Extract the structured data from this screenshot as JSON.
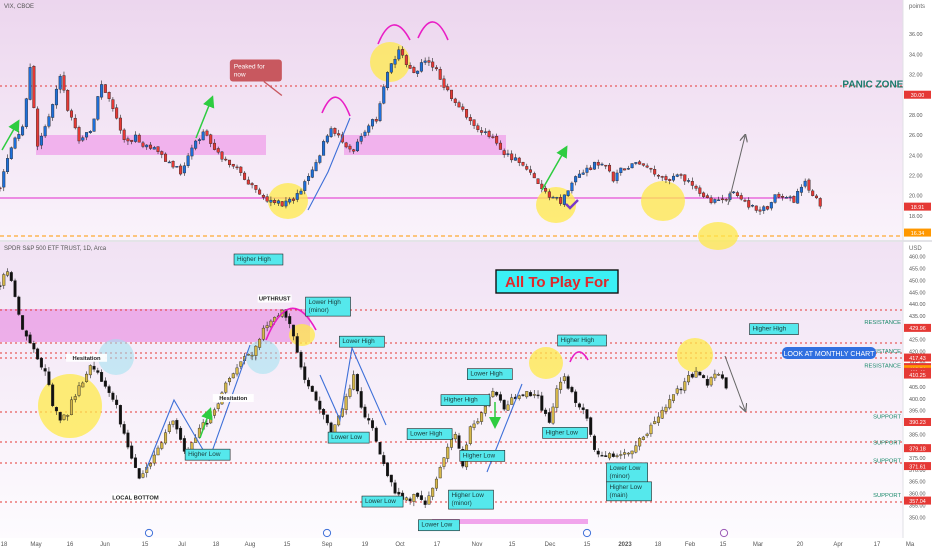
{
  "chart_data": [
    {
      "panel": "top",
      "type": "candlestick",
      "title": "VIX, CBOE",
      "axis_unit": "points",
      "ylim": [
        16,
        38
      ],
      "y_ticks": [
        "36.00",
        "34.00",
        "32.00",
        "30.00",
        "28.00",
        "26.00",
        "24.00",
        "22.00",
        "20.00",
        "18.00"
      ],
      "price_badges": [
        {
          "label": "30.00",
          "value": 30.0,
          "color": "#e53935"
        },
        {
          "label": "18.91",
          "value": 18.91,
          "color": "#e53935"
        },
        {
          "label": "16.34",
          "value": 16.34,
          "color": "#ff9800"
        }
      ],
      "annotations": [
        {
          "text": "Peaked for now",
          "x": 68,
          "y": 32.5
        },
        {
          "text": "PANIC ZONE",
          "x": 232,
          "y": 30.7
        }
      ],
      "close_path": [
        [
          0,
          20.8
        ],
        [
          3,
          25
        ],
        [
          6,
          26.8
        ],
        [
          8,
          32.5
        ],
        [
          10,
          25.2
        ],
        [
          13,
          27.8
        ],
        [
          16,
          32
        ],
        [
          18,
          28.5
        ],
        [
          21,
          25.6
        ],
        [
          24,
          26.2
        ],
        [
          27,
          31.2
        ],
        [
          30,
          28.8
        ],
        [
          33,
          25.4
        ],
        [
          36,
          25.8
        ],
        [
          39,
          24.8
        ],
        [
          42,
          24.3
        ],
        [
          45,
          23.2
        ],
        [
          48,
          22.4
        ],
        [
          51,
          24.8
        ],
        [
          54,
          26.4
        ],
        [
          57,
          24.6
        ],
        [
          60,
          23.4
        ],
        [
          63,
          22.8
        ],
        [
          66,
          21.2
        ],
        [
          69,
          20.4
        ],
        [
          72,
          19.4
        ],
        [
          75,
          19.2
        ],
        [
          78,
          19.6
        ],
        [
          80,
          20.5
        ],
        [
          82,
          21.8
        ],
        [
          85,
          24.2
        ],
        [
          88,
          26.8
        ],
        [
          91,
          25.4
        ],
        [
          94,
          24.6
        ],
        [
          97,
          26.6
        ],
        [
          100,
          27.6
        ],
        [
          103,
          32.4
        ],
        [
          106,
          34.4
        ],
        [
          108,
          33.2
        ],
        [
          110,
          32.2
        ],
        [
          113,
          33.6
        ],
        [
          116,
          32.6
        ],
        [
          119,
          30.2
        ],
        [
          122,
          28.8
        ],
        [
          125,
          27.2
        ],
        [
          128,
          26.4
        ],
        [
          131,
          25.8
        ],
        [
          134,
          24.2
        ],
        [
          137,
          23.6
        ],
        [
          140,
          22.6
        ],
        [
          143,
          21
        ],
        [
          146,
          19.8
        ],
        [
          149,
          19.4
        ],
        [
          152,
          21.2
        ],
        [
          155,
          22.4
        ],
        [
          158,
          23.1
        ],
        [
          161,
          22.8
        ],
        [
          163,
          21.6
        ],
        [
          165,
          22.6
        ],
        [
          168,
          23.1
        ],
        [
          171,
          22.8
        ],
        [
          174,
          22.1
        ],
        [
          177,
          21.6
        ],
        [
          180,
          21.9
        ],
        [
          183,
          21.4
        ],
        [
          186,
          20.1
        ],
        [
          189,
          19.4
        ],
        [
          192,
          19.6
        ],
        [
          195,
          20.1
        ],
        [
          198,
          19.2
        ],
        [
          201,
          18.8
        ],
        [
          204,
          18.5
        ],
        [
          206,
          19.8
        ],
        [
          209,
          20.1
        ],
        [
          211,
          19.6
        ],
        [
          214,
          21.2
        ],
        [
          216,
          20.3
        ],
        [
          218,
          18.9
        ]
      ]
    },
    {
      "panel": "bottom",
      "type": "candlestick",
      "title": "SPDR S&P 500 ETF TRUST, 1D, Arca",
      "axis_unit": "USD",
      "ylim": [
        348,
        462
      ],
      "y_ticks": [
        "460.00",
        "455.00",
        "450.00",
        "445.00",
        "440.00",
        "435.00",
        "430.00",
        "425.00",
        "420.00",
        "415.00",
        "410.00",
        "405.00",
        "400.00",
        "395.00",
        "390.00",
        "385.00",
        "380.00",
        "375.00",
        "370.00",
        "365.00",
        "360.00",
        "355.00",
        "350.00"
      ],
      "price_badges": [
        {
          "label": "429.96",
          "value": 429.96,
          "color": "#e53935"
        },
        {
          "label": "417.43",
          "value": 417.43,
          "color": "#e53935"
        },
        {
          "label": "413.40",
          "value": 413.4,
          "color": "#e53935"
        },
        {
          "label": "412.54",
          "value": 412.54,
          "color": "#ff9800"
        },
        {
          "label": "411.41",
          "value": 411.41,
          "color": "#e53935"
        },
        {
          "label": "410.25",
          "value": 410.25,
          "color": "#e53935"
        },
        {
          "label": "390.23",
          "value": 390.23,
          "color": "#e53935"
        },
        {
          "label": "379.18",
          "value": 379.18,
          "color": "#e53935"
        },
        {
          "label": "371.61",
          "value": 371.61,
          "color": "#e53935"
        },
        {
          "label": "357.04",
          "value": 357.04,
          "color": "#e53935"
        }
      ],
      "level_labels": [
        {
          "text": "RESISTANCE",
          "y": 431.5
        },
        {
          "text": "SUPPORT, NOW ACTING AS RESISTANCE",
          "y": 419.3
        },
        {
          "text": "RESISTANCE",
          "y": 413.3
        },
        {
          "text": "SUPPORT",
          "y": 391.8
        },
        {
          "text": "SUPPORT",
          "y": 380.8
        },
        {
          "text": "SUPPORT",
          "y": 373.2
        },
        {
          "text": "SUPPORT",
          "y": 358.6
        }
      ],
      "headline": "All To Play For",
      "monthly_note": "LOOK AT MONTHLY CHART",
      "annotations": [
        {
          "text": "Higher High",
          "x": 63,
          "y": 458.2
        },
        {
          "text": "UPTHRUST",
          "x": 73,
          "y": 441.5
        },
        {
          "text": "Lower High (minor)",
          "x": 82,
          "y": 440
        },
        {
          "text": "Lower High",
          "x": 91,
          "y": 423.5
        },
        {
          "text": "Higher High",
          "x": 149,
          "y": 424
        },
        {
          "text": "Higher High",
          "x": 200,
          "y": 428.8
        },
        {
          "text": "Hesitation",
          "x": 23,
          "y": 416.5
        },
        {
          "text": "Hesitation",
          "x": 62,
          "y": 399.5
        },
        {
          "text": "Lower High",
          "x": 125,
          "y": 409.8
        },
        {
          "text": "Higher High",
          "x": 118,
          "y": 398.8
        },
        {
          "text": "Higher Low",
          "x": 50,
          "y": 375.8
        },
        {
          "text": "Lower High",
          "x": 109,
          "y": 384.5
        },
        {
          "text": "Lower Low",
          "x": 88,
          "y": 383
        },
        {
          "text": "Higher Low",
          "x": 145,
          "y": 385
        },
        {
          "text": "Higher Low",
          "x": 123,
          "y": 375.3
        },
        {
          "text": "Lower Low (minor)",
          "x": 162,
          "y": 370
        },
        {
          "text": "Higher Low (main)",
          "x": 162,
          "y": 362
        },
        {
          "text": "Higher Low (minor)",
          "x": 120,
          "y": 358.5
        },
        {
          "text": "Lower Low",
          "x": 97,
          "y": 356
        },
        {
          "text": "Lower Low",
          "x": 112,
          "y": 346
        },
        {
          "text": "LOCAL BOTTOM",
          "x": 36,
          "y": 357.5
        }
      ],
      "close_path": [
        [
          0,
          448
        ],
        [
          2,
          455
        ],
        [
          4,
          443
        ],
        [
          6,
          430
        ],
        [
          8,
          424
        ],
        [
          10,
          417
        ],
        [
          12,
          412
        ],
        [
          14,
          398
        ],
        [
          16,
          390
        ],
        [
          18,
          394
        ],
        [
          20,
          402
        ],
        [
          22,
          406
        ],
        [
          24,
          413
        ],
        [
          26,
          410
        ],
        [
          28,
          405
        ],
        [
          31,
          396
        ],
        [
          34,
          380
        ],
        [
          37,
          367
        ],
        [
          40,
          372
        ],
        [
          43,
          383
        ],
        [
          46,
          392
        ],
        [
          49,
          377
        ],
        [
          52,
          384
        ],
        [
          55,
          391
        ],
        [
          58,
          398
        ],
        [
          61,
          410
        ],
        [
          64,
          416
        ],
        [
          67,
          418
        ],
        [
          70,
          431
        ],
        [
          72,
          434
        ],
        [
          75,
          438
        ],
        [
          78,
          428
        ],
        [
          80,
          414
        ],
        [
          82,
          404
        ],
        [
          85,
          397
        ],
        [
          88,
          384
        ],
        [
          90,
          392
        ],
        [
          92,
          401
        ],
        [
          94,
          409
        ],
        [
          96,
          396
        ],
        [
          99,
          387
        ],
        [
          102,
          371
        ],
        [
          105,
          361
        ],
        [
          108,
          357
        ],
        [
          111,
          360
        ],
        [
          113,
          354
        ],
        [
          116,
          366
        ],
        [
          119,
          380
        ],
        [
          121,
          385
        ],
        [
          123,
          372
        ],
        [
          125,
          388
        ],
        [
          128,
          394
        ],
        [
          131,
          402
        ],
        [
          134,
          397
        ],
        [
          137,
          401
        ],
        [
          140,
          403
        ],
        [
          143,
          400
        ],
        [
          146,
          390
        ],
        [
          148,
          405
        ],
        [
          150,
          408
        ],
        [
          152,
          402
        ],
        [
          154,
          397
        ],
        [
          156,
          392
        ],
        [
          158,
          378
        ],
        [
          161,
          376
        ],
        [
          164,
          375
        ],
        [
          167,
          378
        ],
        [
          170,
          382
        ],
        [
          173,
          388
        ],
        [
          176,
          396
        ],
        [
          179,
          401
        ],
        [
          182,
          407
        ],
        [
          185,
          412
        ],
        [
          188,
          407
        ],
        [
          191,
          412
        ],
        [
          193,
          406
        ]
      ]
    }
  ],
  "x_axis": {
    "labels": [
      "18",
      "May",
      "16",
      "Jun",
      "15",
      "Jul",
      "18",
      "Aug",
      "15",
      "Sep",
      "19",
      "Oct",
      "17",
      "Nov",
      "15",
      "Dec",
      "15",
      "2023",
      "18",
      "Feb",
      "15",
      "Mar",
      "20",
      "Apr",
      "17",
      "Ma"
    ]
  }
}
